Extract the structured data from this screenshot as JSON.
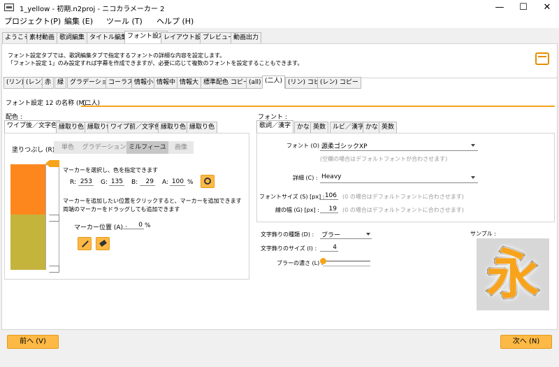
{
  "window": {
    "title": "1_yellow - 初期.n2proj - ニコカラメーカー 2",
    "min": "—",
    "max": "☐",
    "close": "✕"
  },
  "menu": [
    "プロジェクト(P)",
    "編集 (E)",
    "ツール (T)",
    "ヘルプ (H)"
  ],
  "main_tabs": [
    "ようこそ",
    "素材動画",
    "歌詞編集",
    "タイトル編集",
    "フォント設定",
    "レイアウト設定",
    "プレビュー",
    "動画出力"
  ],
  "active_main_tab": "フォント設定",
  "description": [
    "フォント設定タブでは、歌詞編集タブで指定するフォントの詳細な内容を設定します。",
    "「フォント設定 1」のみ設定すれば字幕を作成できますが、必要に応じて複数のフォントを設定することもできます。"
  ],
  "font_tabs": [
    "(リン)",
    "(レン)",
    "赤",
    "緑",
    "グラデーション",
    "コーラス",
    "情報小",
    "情報中",
    "情報大",
    "標準配色 コピー",
    "(all)",
    "(二人)",
    "(リン) コピー",
    "(レン) コピー"
  ],
  "active_font_tab": "(二人)",
  "name_field": {
    "label": "フォント設定 12 の名称 (M) :",
    "value": "(二人)"
  },
  "color": {
    "section_label": "配色 :",
    "tabs": [
      "ワイプ後／文字色",
      "縁取り色",
      "縁取り色",
      "ワイプ前／文字色",
      "縁取り色",
      "縁取り色"
    ],
    "fill_label": "塗りつぶし (R) :",
    "fill_options": [
      "単色",
      "グラデーション",
      "ミルフィーユ",
      "画像"
    ],
    "fill_selected": "ミルフィーユ",
    "marker_hint": "マーカーを選択し、色を指定できます",
    "r_label": "R:",
    "r": "253",
    "g_label": "G:",
    "g": "135",
    "b_label": "B:",
    "b": "29",
    "a_label": "A:",
    "a": "100",
    "a_unit": "%",
    "add_hint_1": "マーカーを追加したい位置をクリックすると、マーカーを追加できます",
    "add_hint_2": "両端のマーカーをドラッグしても追加できます",
    "marker_pos_label": "マーカー位置 (A) :",
    "marker_pos": "0",
    "marker_pos_unit": "%",
    "swatch_top": "#fd871d",
    "swatch_bottom": "#c4b43c"
  },
  "font": {
    "section_label": "フォント :",
    "tabs": [
      "歌詞／漢字",
      "かな",
      "英数",
      "ルビ／漢字",
      "かな",
      "英数"
    ],
    "font_label": "フォント (O) :",
    "font_value": "源柔ゴシックXP",
    "font_hint": "(空欄の場合はデフォルトフォントが合わさせます)",
    "detail_label": "詳細 (C) :",
    "detail_value": "Heavy",
    "size_label": "フォントサイズ (S) [px] :",
    "size_value": "106",
    "size_hint": "(0 の場合はデフォルトフォントに合わさせます)",
    "line_label": "線の幅 (G) [px] :",
    "line_value": "19",
    "line_hint": "(0 の場合はデフォルトフォントに合わさせます)",
    "deco_type_label": "文字飾りの種類 (D) :",
    "deco_type_value": "ブラー",
    "deco_size_label": "文字飾りのサイズ (I) :",
    "deco_size_value": "4",
    "blur_label": "ブラーの濃さ (L) :",
    "blur_level": 0.0,
    "sample_label": "サンプル :",
    "sample_char": "永"
  },
  "nav": {
    "prev": "前へ (V)",
    "next": "次へ (N)"
  },
  "colors": {
    "accent": "#f7a31c",
    "button": "#fdb945"
  }
}
